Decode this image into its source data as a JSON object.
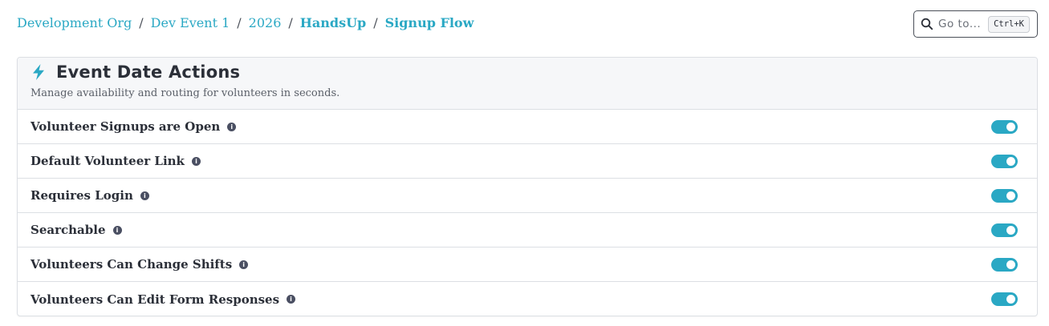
{
  "breadcrumb": {
    "items": [
      {
        "label": "Development Org",
        "bold": false
      },
      {
        "label": "Dev Event 1",
        "bold": false
      },
      {
        "label": "2026",
        "bold": false
      },
      {
        "label": "HandsUp",
        "bold": true
      },
      {
        "label": "Signup Flow",
        "bold": true
      }
    ],
    "separator": "/"
  },
  "search": {
    "placeholder": "Go to...",
    "shortcut": "Ctrl+K",
    "icon": "search-icon"
  },
  "card": {
    "icon": "bolt-icon",
    "title": "Event Date Actions",
    "subtitle": "Manage availability and routing for volunteers in seconds.",
    "settings": [
      {
        "label": "Volunteer Signups are Open",
        "enabled": true
      },
      {
        "label": "Default Volunteer Link",
        "enabled": true
      },
      {
        "label": "Requires Login",
        "enabled": true
      },
      {
        "label": "Searchable",
        "enabled": true
      },
      {
        "label": "Volunteers Can Change Shifts",
        "enabled": true
      },
      {
        "label": "Volunteers Can Edit Form Responses",
        "enabled": true
      }
    ]
  },
  "colors": {
    "accent": "#2aa8c4",
    "text": "#2b2f38",
    "info_icon": "#4a4f62"
  }
}
